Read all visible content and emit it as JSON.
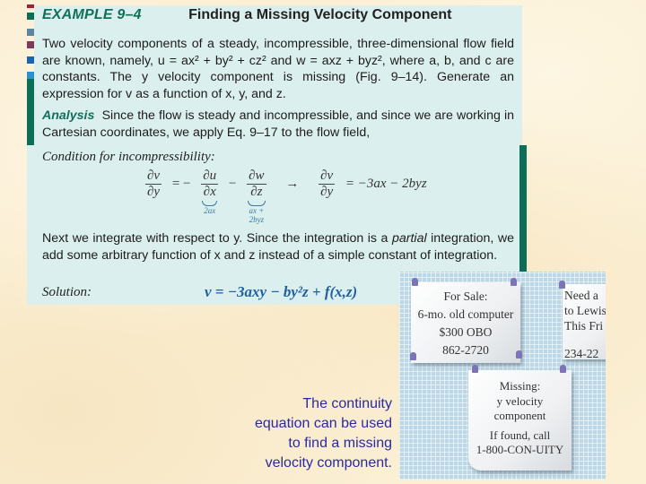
{
  "example": {
    "label": "EXAMPLE 9–4",
    "title": "Finding a Missing Velocity Component"
  },
  "problem": {
    "text": "Two velocity components of a steady, incompressible, three-dimensional flow field are known, namely, u = ax² + by² + cz² and w = axz + byz², where a, b, and c are constants. The y velocity component is missing (Fig. 9–14). Generate an expression for v as a function of x, y, and z."
  },
  "analysis": {
    "label": "Analysis",
    "text": "Since the flow is steady and incompressible, and since we are working in Cartesian coordinates, we apply Eq. 9–17 to the flow field,"
  },
  "condition": {
    "label": "Condition for incompressibility:",
    "lhs_num": "∂v",
    "lhs_den": "∂y",
    "eq1": "= −",
    "t1_num": "∂u",
    "t1_den": "∂x",
    "t1_brace": "2ax",
    "minus": "−",
    "t2_num": "∂w",
    "t2_den": "∂z",
    "t2_brace": "ax + 2byz",
    "arrow": "→",
    "rhs_num": "∂v",
    "rhs_den": "∂y",
    "rhs": "= −3ax − 2byz"
  },
  "integration": {
    "text_before": "Next we integrate with respect to y. Since the integration is a ",
    "italic": "partial",
    "text_after": " integration, we add some arbitrary function of x and z instead of a simple constant of integration."
  },
  "solution": {
    "label": "Solution:",
    "equation": "v = −3axy − by²z + f(x,z)"
  },
  "figure": {
    "note1": [
      "For Sale:",
      "6-mo. old computer",
      "$300 OBO",
      "862-2720"
    ],
    "note2": [
      "Need a",
      "to Lewis",
      "This Fri",
      "",
      "234-22"
    ],
    "note3": [
      "Missing:",
      "y velocity",
      "component",
      "If found, call",
      "1-800-CON-UITY"
    ]
  },
  "caption": {
    "lines": [
      "The continuity",
      "equation can be used",
      "to find a missing",
      "velocity component."
    ]
  },
  "colors": {
    "accent_green": "#0d6e58",
    "panel_bg": "#dcefef",
    "solution_blue": "#2060a0",
    "caption_blue": "#2a2aa0",
    "bar_colors": [
      "#9b2335",
      "#0d6e58",
      "#5a86a0",
      "#7d3a5a",
      "#1a64b0",
      "#2a90d0"
    ]
  }
}
